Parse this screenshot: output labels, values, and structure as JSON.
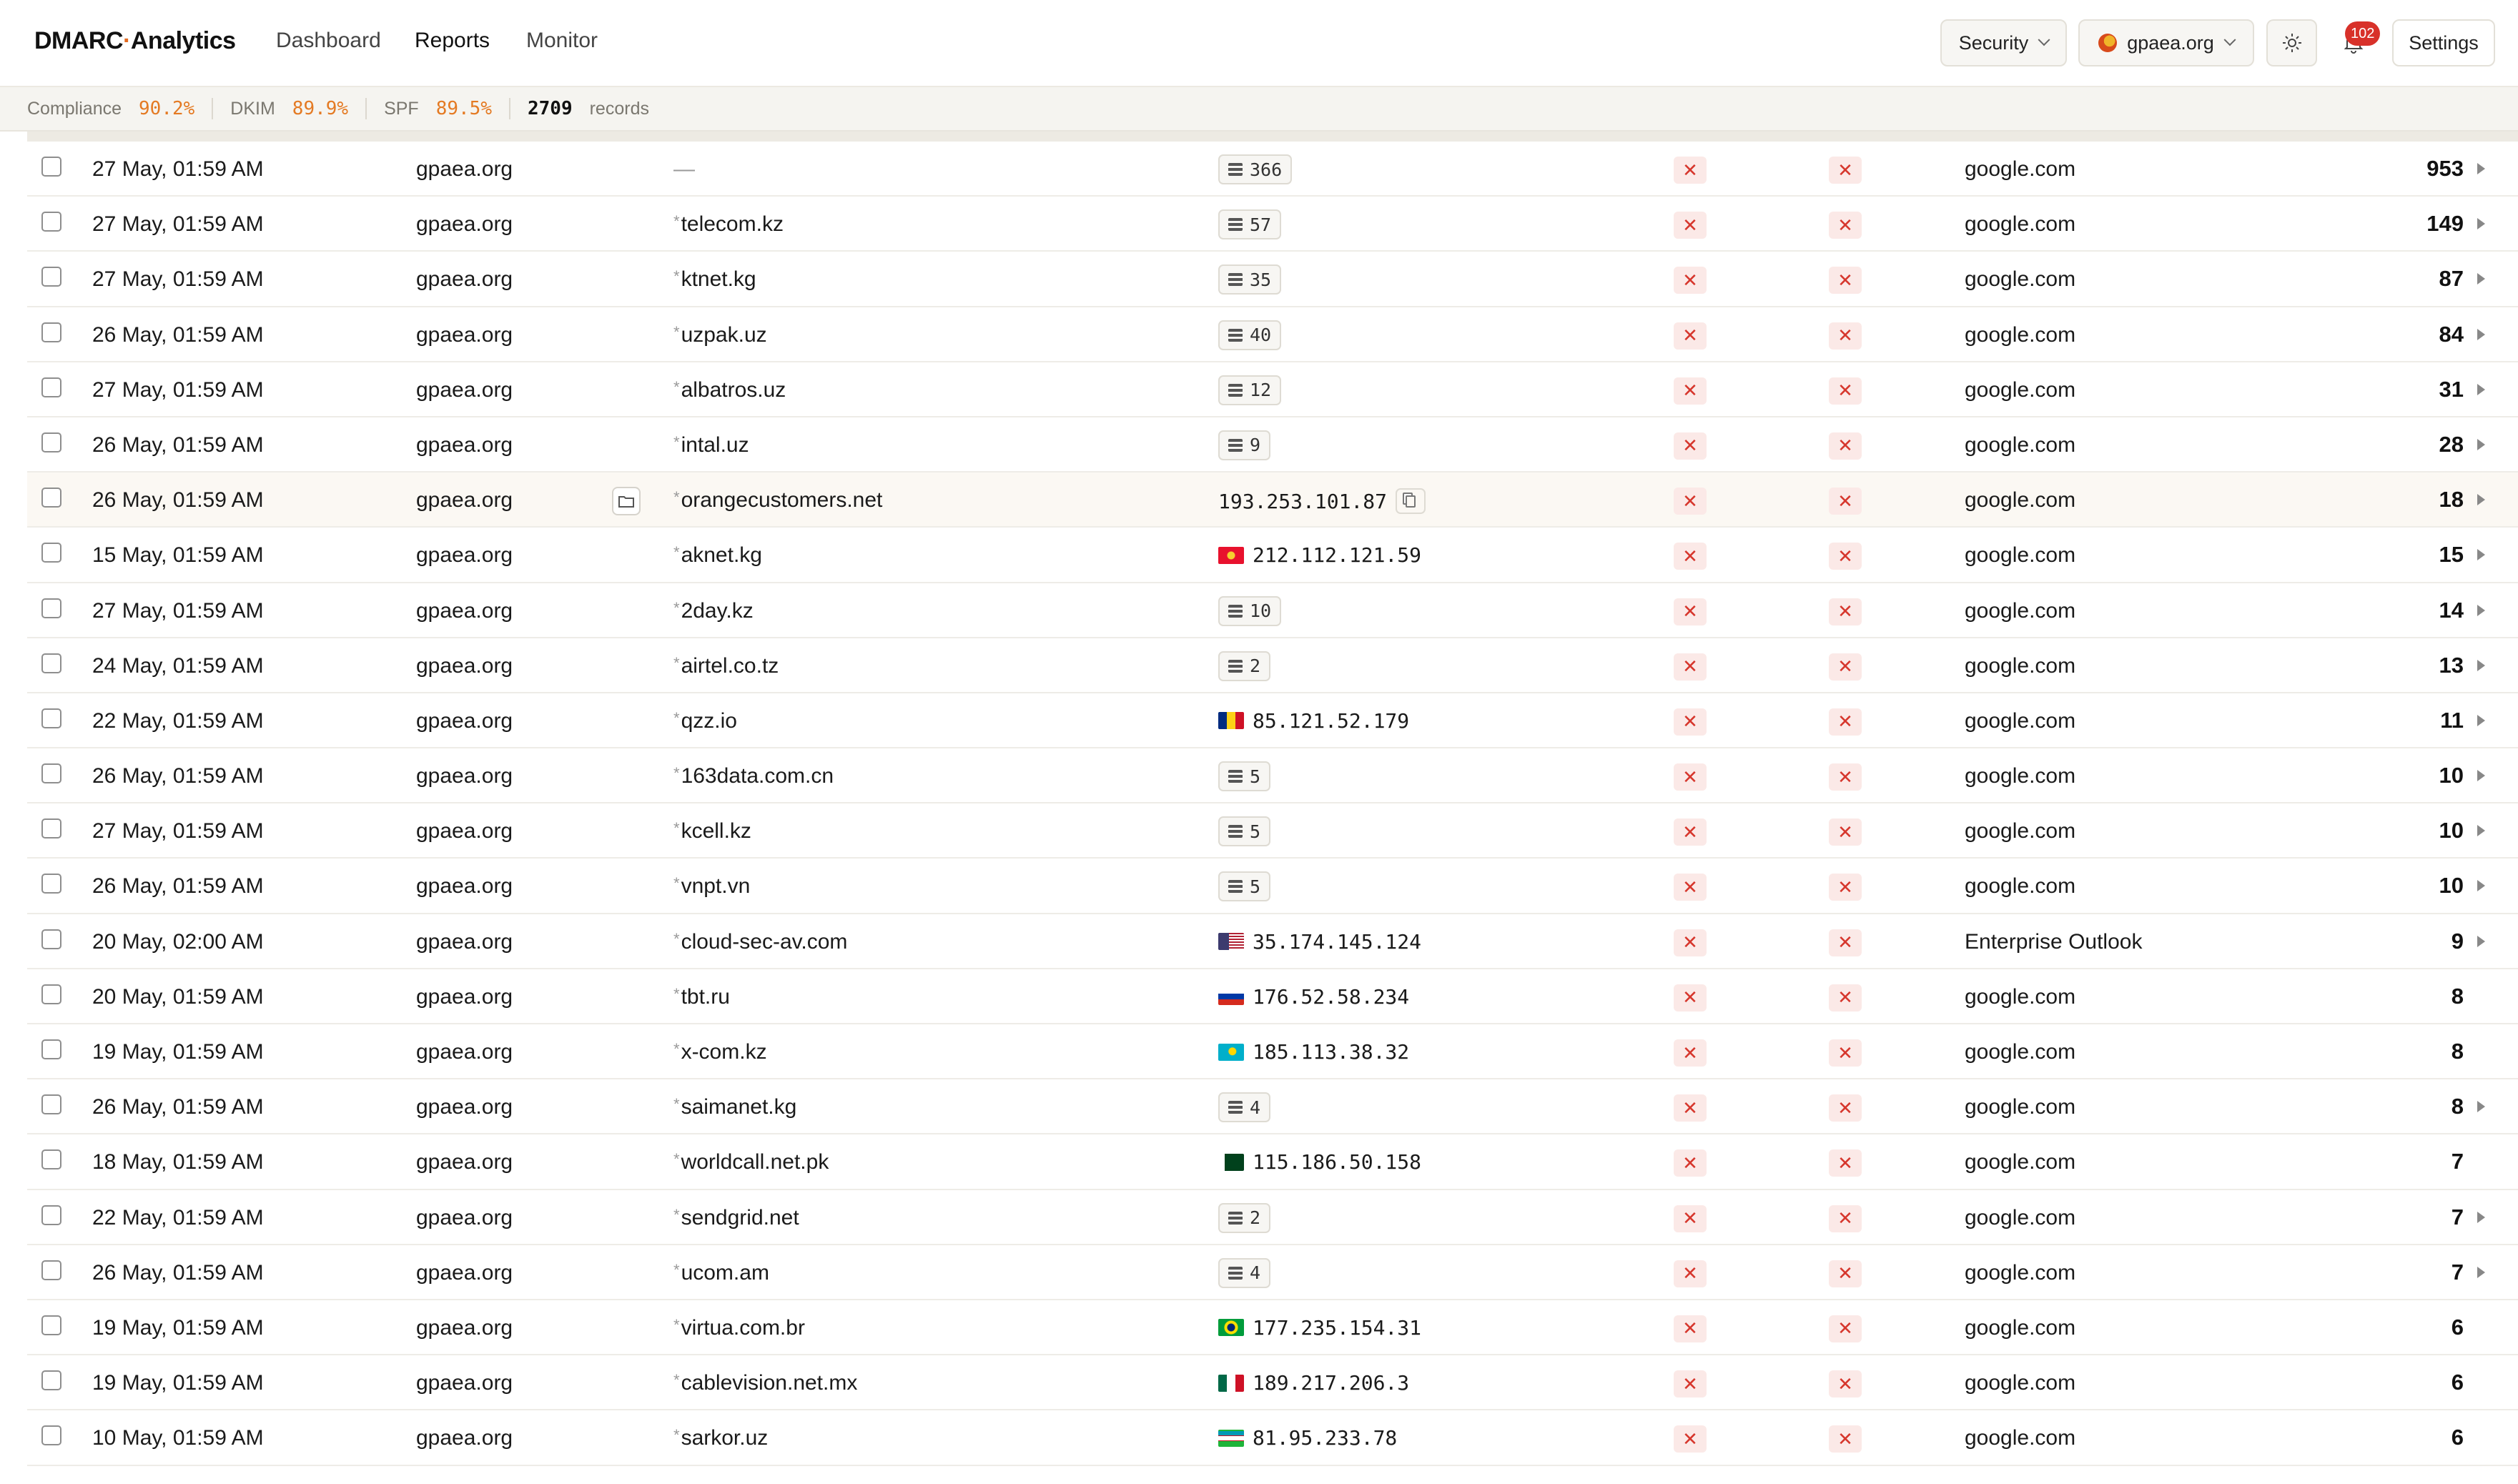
{
  "header": {
    "brand_prefix": "DMARC",
    "brand_dot": "·",
    "brand_suffix": "Analytics",
    "nav": [
      "Dashboard",
      "Reports",
      "Monitor"
    ],
    "active_nav": "Reports",
    "security_label": "Security",
    "domain_label": "gpaea.org",
    "notification_count": "102",
    "settings_label": "Settings"
  },
  "stats": {
    "compliance_label": "Compliance",
    "compliance_value": "90.2%",
    "dkim_label": "DKIM",
    "dkim_value": "89.9%",
    "spf_label": "SPF",
    "spf_value": "89.5%",
    "records_count": "2709",
    "records_label": "records"
  },
  "colors": {
    "accent": "#e47a23",
    "fail": "#d6362c",
    "fail_bg": "#fbe9e7",
    "badge": "#d8312a"
  },
  "fail_symbol": "✕",
  "rows": [
    {
      "date": "27 May, 01:59 AM",
      "domain": "gpaea.org",
      "host": "—",
      "wildcard": false,
      "source": {
        "type": "servers",
        "count": "366"
      },
      "org": "google.com",
      "count": "953",
      "expandable": true
    },
    {
      "date": "27 May, 01:59 AM",
      "domain": "gpaea.org",
      "host": "telecom.kz",
      "wildcard": true,
      "source": {
        "type": "servers",
        "count": "57"
      },
      "org": "google.com",
      "count": "149",
      "expandable": true
    },
    {
      "date": "27 May, 01:59 AM",
      "domain": "gpaea.org",
      "host": "ktnet.kg",
      "wildcard": true,
      "source": {
        "type": "servers",
        "count": "35"
      },
      "org": "google.com",
      "count": "87",
      "expandable": true
    },
    {
      "date": "26 May, 01:59 AM",
      "domain": "gpaea.org",
      "host": "uzpak.uz",
      "wildcard": true,
      "source": {
        "type": "servers",
        "count": "40"
      },
      "org": "google.com",
      "count": "84",
      "expandable": true
    },
    {
      "date": "27 May, 01:59 AM",
      "domain": "gpaea.org",
      "host": "albatros.uz",
      "wildcard": true,
      "source": {
        "type": "servers",
        "count": "12"
      },
      "org": "google.com",
      "count": "31",
      "expandable": true
    },
    {
      "date": "26 May, 01:59 AM",
      "domain": "gpaea.org",
      "host": "intal.uz",
      "wildcard": true,
      "source": {
        "type": "servers",
        "count": "9"
      },
      "org": "google.com",
      "count": "28",
      "expandable": true
    },
    {
      "date": "26 May, 01:59 AM",
      "domain": "gpaea.org",
      "host": "orangecustomers.net",
      "wildcard": true,
      "highlight": true,
      "folder": true,
      "source": {
        "type": "ip",
        "ip": "193.253.101.87",
        "flag": "",
        "copy": true
      },
      "org": "google.com",
      "count": "18",
      "expandable": true
    },
    {
      "date": "15 May, 01:59 AM",
      "domain": "gpaea.org",
      "host": "aknet.kg",
      "wildcard": true,
      "source": {
        "type": "ip",
        "ip": "212.112.121.59",
        "flag": "kg"
      },
      "org": "google.com",
      "count": "15",
      "expandable": true
    },
    {
      "date": "27 May, 01:59 AM",
      "domain": "gpaea.org",
      "host": "2day.kz",
      "wildcard": true,
      "source": {
        "type": "servers",
        "count": "10"
      },
      "org": "google.com",
      "count": "14",
      "expandable": true
    },
    {
      "date": "24 May, 01:59 AM",
      "domain": "gpaea.org",
      "host": "airtel.co.tz",
      "wildcard": true,
      "source": {
        "type": "servers",
        "count": "2"
      },
      "org": "google.com",
      "count": "13",
      "expandable": true
    },
    {
      "date": "22 May, 01:59 AM",
      "domain": "gpaea.org",
      "host": "qzz.io",
      "wildcard": true,
      "source": {
        "type": "ip",
        "ip": "85.121.52.179",
        "flag": "ro"
      },
      "org": "google.com",
      "count": "11",
      "expandable": true
    },
    {
      "date": "26 May, 01:59 AM",
      "domain": "gpaea.org",
      "host": "163data.com.cn",
      "wildcard": true,
      "source": {
        "type": "servers",
        "count": "5"
      },
      "org": "google.com",
      "count": "10",
      "expandable": true
    },
    {
      "date": "27 May, 01:59 AM",
      "domain": "gpaea.org",
      "host": "kcell.kz",
      "wildcard": true,
      "source": {
        "type": "servers",
        "count": "5"
      },
      "org": "google.com",
      "count": "10",
      "expandable": true
    },
    {
      "date": "26 May, 01:59 AM",
      "domain": "gpaea.org",
      "host": "vnpt.vn",
      "wildcard": true,
      "source": {
        "type": "servers",
        "count": "5"
      },
      "org": "google.com",
      "count": "10",
      "expandable": true
    },
    {
      "date": "20 May, 02:00 AM",
      "domain": "gpaea.org",
      "host": "cloud-sec-av.com",
      "wildcard": true,
      "source": {
        "type": "ip",
        "ip": "35.174.145.124",
        "flag": "us"
      },
      "org": "Enterprise Outlook",
      "count": "9",
      "expandable": true
    },
    {
      "date": "20 May, 01:59 AM",
      "domain": "gpaea.org",
      "host": "tbt.ru",
      "wildcard": true,
      "source": {
        "type": "ip",
        "ip": "176.52.58.234",
        "flag": "ru"
      },
      "org": "google.com",
      "count": "8",
      "expandable": false
    },
    {
      "date": "19 May, 01:59 AM",
      "domain": "gpaea.org",
      "host": "x-com.kz",
      "wildcard": true,
      "source": {
        "type": "ip",
        "ip": "185.113.38.32",
        "flag": "kz"
      },
      "org": "google.com",
      "count": "8",
      "expandable": false
    },
    {
      "date": "26 May, 01:59 AM",
      "domain": "gpaea.org",
      "host": "saimanet.kg",
      "wildcard": true,
      "source": {
        "type": "servers",
        "count": "4"
      },
      "org": "google.com",
      "count": "8",
      "expandable": true
    },
    {
      "date": "18 May, 01:59 AM",
      "domain": "gpaea.org",
      "host": "worldcall.net.pk",
      "wildcard": true,
      "source": {
        "type": "ip",
        "ip": "115.186.50.158",
        "flag": "pk"
      },
      "org": "google.com",
      "count": "7",
      "expandable": false
    },
    {
      "date": "22 May, 01:59 AM",
      "domain": "gpaea.org",
      "host": "sendgrid.net",
      "wildcard": true,
      "source": {
        "type": "servers",
        "count": "2"
      },
      "org": "google.com",
      "count": "7",
      "expandable": true
    },
    {
      "date": "26 May, 01:59 AM",
      "domain": "gpaea.org",
      "host": "ucom.am",
      "wildcard": true,
      "source": {
        "type": "servers",
        "count": "4"
      },
      "org": "google.com",
      "count": "7",
      "expandable": true
    },
    {
      "date": "19 May, 01:59 AM",
      "domain": "gpaea.org",
      "host": "virtua.com.br",
      "wildcard": true,
      "source": {
        "type": "ip",
        "ip": "177.235.154.31",
        "flag": "br"
      },
      "org": "google.com",
      "count": "6",
      "expandable": false
    },
    {
      "date": "19 May, 01:59 AM",
      "domain": "gpaea.org",
      "host": "cablevision.net.mx",
      "wildcard": true,
      "source": {
        "type": "ip",
        "ip": "189.217.206.3",
        "flag": "mx"
      },
      "org": "google.com",
      "count": "6",
      "expandable": false
    },
    {
      "date": "10 May, 01:59 AM",
      "domain": "gpaea.org",
      "host": "sarkor.uz",
      "wildcard": true,
      "source": {
        "type": "ip",
        "ip": "81.95.233.78",
        "flag": "uz"
      },
      "org": "google.com",
      "count": "6",
      "expandable": false
    }
  ]
}
